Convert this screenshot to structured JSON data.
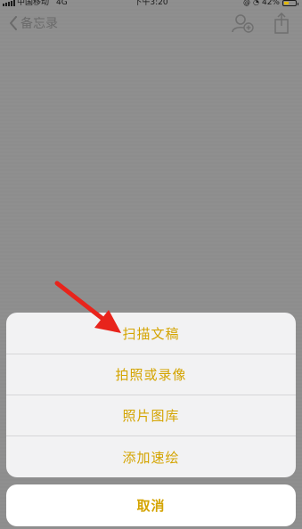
{
  "status_bar": {
    "carrier": "中国移动",
    "network": "4G",
    "time": "下午3:20",
    "battery": "42%",
    "battery_level": 0.42
  },
  "nav": {
    "back_label": "备忘录"
  },
  "action_sheet": {
    "items": [
      {
        "label": "扫描文稿"
      },
      {
        "label": "拍照或录像"
      },
      {
        "label": "照片图库"
      },
      {
        "label": "添加速绘"
      }
    ],
    "cancel_label": "取消"
  },
  "colors": {
    "accent": "#d4a400",
    "annotation_arrow": "#e8241c"
  }
}
